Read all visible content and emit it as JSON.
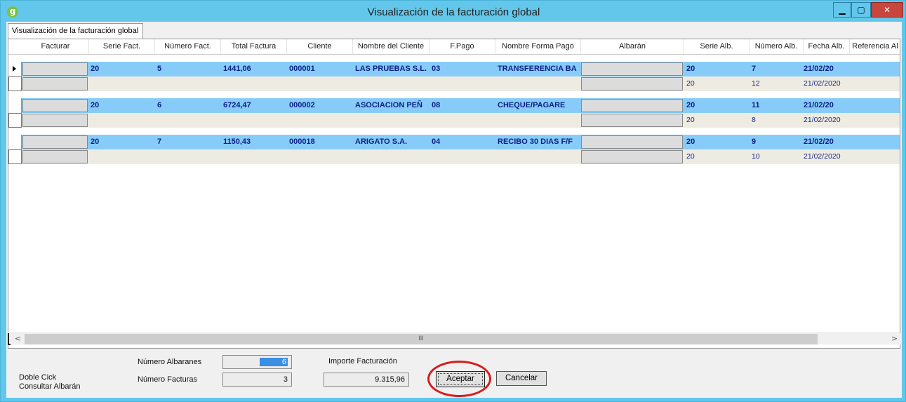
{
  "window": {
    "title": "Visualización de la facturación global",
    "app_icon_letter": "g",
    "controls": {
      "minimize": "▁",
      "maximize": "▢",
      "close": "✕"
    }
  },
  "tab": {
    "label": "Visualización de la facturación global"
  },
  "grid": {
    "columns": [
      "Facturar",
      "Serie Fact.",
      "Número Fact.",
      "Total Factura",
      "Cliente",
      "Nombre del Cliente",
      "F.Pago",
      "Nombre Forma Pago",
      "Albarán",
      "Serie Alb.",
      "Número Alb.",
      "Fecha Alb.",
      "Referencia Al"
    ],
    "invoices": [
      {
        "serie": "20",
        "numero": "5",
        "total": "1441,06",
        "cliente": "000001",
        "nombre": "LAS PRUEBAS S.L.",
        "fpago": "03",
        "forma_pago": "TRANSFERENCIA BA",
        "albaranes": [
          {
            "serie": "20",
            "numero": "7",
            "fecha": "21/02/20"
          },
          {
            "serie": "20",
            "numero": "12",
            "fecha": "21/02/2020"
          }
        ]
      },
      {
        "serie": "20",
        "numero": "6",
        "total": "6724,47",
        "cliente": "000002",
        "nombre": "ASOCIACION PEÑ",
        "fpago": "08",
        "forma_pago": "CHEQUE/PAGARE",
        "albaranes": [
          {
            "serie": "20",
            "numero": "11",
            "fecha": "21/02/20"
          },
          {
            "serie": "20",
            "numero": "8",
            "fecha": "21/02/2020"
          }
        ]
      },
      {
        "serie": "20",
        "numero": "7",
        "total": "1150,43",
        "cliente": "000018",
        "nombre": "ARIGATO S.A.",
        "fpago": "04",
        "forma_pago": "RECIBO 30 DIAS F/F",
        "albaranes": [
          {
            "serie": "20",
            "numero": "9",
            "fecha": "21/02/20"
          },
          {
            "serie": "20",
            "numero": "10",
            "fecha": "21/02/2020"
          }
        ]
      }
    ],
    "scrollbar": {
      "left": "<",
      "right": ">",
      "thumb_grip": "III"
    }
  },
  "footer": {
    "hint_line1": "Doble Cick",
    "hint_line2": "Consultar Albarán",
    "numero_albaranes_label": "Número Albaranes",
    "numero_albaranes_value": "6",
    "numero_facturas_label": "Número Facturas",
    "numero_facturas_value": "3",
    "importe_label": "Importe Facturación",
    "importe_value": "9.315,96",
    "aceptar_label": "Aceptar",
    "cancelar_label": "Cancelar"
  },
  "colors": {
    "title_bar": "#62c7eb",
    "selected_row": "#87ccf8",
    "sub_row": "#eeebe2",
    "row_text": "#0c1f84",
    "highlight_ring": "#d61d1d"
  }
}
